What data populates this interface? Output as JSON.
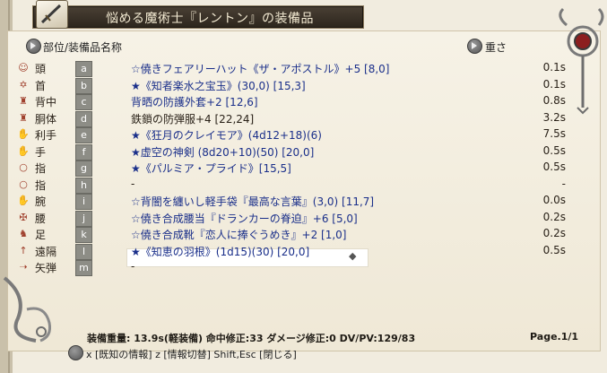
{
  "window": {
    "title": "悩める魔術士『レントン』の装備品"
  },
  "header": {
    "col_slot": "部位/装備品名称",
    "col_weight": "重さ"
  },
  "rows": [
    {
      "icon": "☺",
      "slot": "頭",
      "key": "a",
      "name": "☆僥きフェアリーハット《ザ・アポストル》+5 [8,0]",
      "weight": "0.1s",
      "color": "blue"
    },
    {
      "icon": "✡",
      "slot": "首",
      "key": "b",
      "name": "★《知者楽水之宝玉》(30,0) [15,3]",
      "weight": "0.1s",
      "color": "blue"
    },
    {
      "icon": "♜",
      "slot": "背中",
      "key": "c",
      "name": "背晒の防護外套+2 [12,6]",
      "weight": "0.8s",
      "color": "blue"
    },
    {
      "icon": "♜",
      "slot": "胴体",
      "key": "d",
      "name": "鉄鎖の防弾服+4 [22,24]",
      "weight": "3.2s",
      "color": "dark"
    },
    {
      "icon": "✋",
      "slot": "利手",
      "key": "e",
      "name": "★《狂月のクレイモア》(4d12+18)(6)",
      "weight": "7.5s",
      "color": "blue"
    },
    {
      "icon": "✋",
      "slot": "手",
      "key": "f",
      "name": "★虚空の神剣 (8d20+10)(50) [20,0]",
      "weight": "0.5s",
      "color": "blue"
    },
    {
      "icon": "○",
      "slot": "指",
      "key": "g",
      "name": "★《パルミア・プライド》[15,5]",
      "weight": "0.5s",
      "color": "blue"
    },
    {
      "icon": "○",
      "slot": "指",
      "key": "h",
      "name": "-",
      "weight": "-",
      "color": "dark"
    },
    {
      "icon": "✋",
      "slot": "腕",
      "key": "i",
      "name": "☆背闇を纏いし軽手袋『最高な言葉』(3,0) [11,7]",
      "weight": "0.0s",
      "color": "blue"
    },
    {
      "icon": "✠",
      "slot": "腰",
      "key": "j",
      "name": "☆僥き合成腰当『ドランカーの脊迫』+6 [5,0]",
      "weight": "0.2s",
      "color": "blue"
    },
    {
      "icon": "♞",
      "slot": "足",
      "key": "k",
      "name": "☆僥き合成靴『恋人に捧ぐうめき』+2 [1,0]",
      "weight": "0.2s",
      "color": "blue"
    },
    {
      "icon": "↑",
      "slot": "遠隔",
      "key": "l",
      "name": "★《知恵の羽根》(1d15)(30) [20,0]",
      "weight": "0.5s",
      "color": "blue"
    },
    {
      "icon": "➝",
      "slot": "矢弾",
      "key": "m",
      "name": "-",
      "weight": "",
      "color": "dark"
    }
  ],
  "footer": {
    "stats": "装備重量: 13.9s(軽装備) 命中修正:33 ダメージ修正:0  DV/PV:129/83",
    "page": "Page.1/1",
    "help": "x [既知の情報]  z [情報切替]  Shift,Esc [閉じる]"
  }
}
